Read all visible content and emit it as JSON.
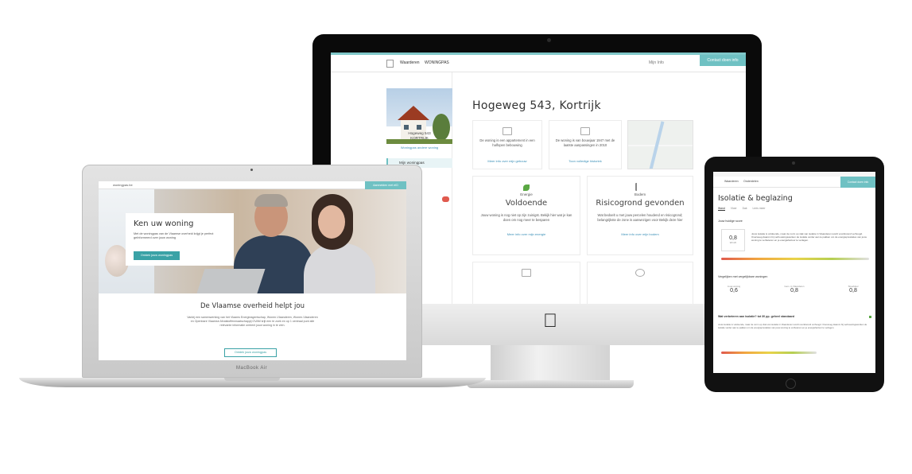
{
  "imac": {
    "nav": {
      "logo_text": "",
      "item1": "Waarderen",
      "item2": "WONINGPAS",
      "user": "Mijn Info",
      "cta": "Contact doen info"
    },
    "sidebar": {
      "address_line1": "Hogeweg 543",
      "address_line2": "KORTRIJK",
      "link": "Woningpas andere woning",
      "menu_item": "Mijn woningpas"
    },
    "title": "Hogeweg 543, Kortrijk",
    "cards": [
      {
        "text": "De woning is een appartement in een halfopen bebouwing",
        "link": "Meer info over mijn gebouw"
      },
      {
        "text": "De woning is van bouwjaar 1947 met de laatste aanpassingen in 2010",
        "link": "Toon volledige historiek"
      },
      {
        "label": "Energie",
        "big": "Voldoende",
        "text": "Jouw woning is nog niet op zijn zuinigst. Bekijk hier wat je kan doen om nog meer te besparen",
        "link": "Meer info over mijn energie"
      },
      {
        "label": "Bodem",
        "big": "Risicogrond gevonden",
        "text": "Wat bedoelt u met jouw percelen houdend en risicogrond; belangrijkste de zone is aanwezigen voor Bekijk deze hier",
        "link": "Meer info over mijn bodem"
      }
    ]
  },
  "macbook": {
    "label": "MacBook Air",
    "nav": {
      "brand": "woningpas.be",
      "cta": "Aanmelden met eID"
    },
    "hero": {
      "title": "Ken uw woning",
      "text": "Met de woningpas van de Vlaamse overheid krijgt je perfect geïnformeerd over jouw woning",
      "button": "Ontdek jouw woningpas"
    },
    "heading": "De Vlaamse overheid helpt jou",
    "paragraph": "Vanbij een samenwerking van het Vlaams Energieagentschap, Wonen-Vlaanderen, Wonen-Vlaanderen en Openbare Vlaamse Afvalstoffenmaatschappij OVAM krijt een te zoek en op 1 centraal punt alle relevante informatie omtrent jouw woning in te zien.",
    "button2": "Ontdek jouw woningpas"
  },
  "ipad": {
    "nav": {
      "item1": "Waarderen",
      "item2": "Onderdelen",
      "cta": "Contact doen info"
    },
    "title": "Isolatie & beglazing",
    "tabs": [
      "Wand",
      "Vloer",
      "Dak",
      "Lees meer"
    ],
    "section1": "Jouw huidige score",
    "score_value": "0,8",
    "score_sub": "W/m²K",
    "section2": "Vergelijken met vergelijkbare woningen",
    "compare": [
      {
        "label": "Jouw woning",
        "value": "0,6"
      },
      {
        "label": "Gem. in Vlaanderen",
        "value": "0,8"
      },
      {
        "label": "Streefdoel",
        "value": "0,8"
      }
    ],
    "section3": "Wat verbeteren aan isolatie? tot 30 pp. geheel standaard",
    "body": "Jouw isolatie is voldoende, maar de norm op vlak van isolatie in Vlaanderen wordt voortdurend verhoogd. Overweeg daarom bij verbouwingswerken de isolatie verder aan te pakken om de energieprestaties van jouw woning te verbeteren en je energiefactuur te verlagen."
  },
  "colors": {
    "accent": "#6fc1c3",
    "link": "#3a8fb7",
    "alert": "#e05a4e",
    "energy": "#5aa843"
  }
}
